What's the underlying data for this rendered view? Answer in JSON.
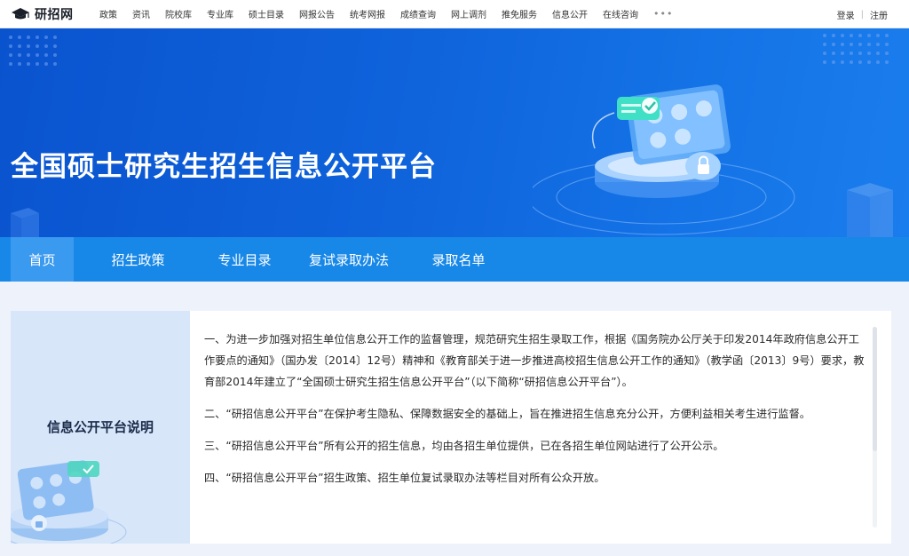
{
  "site": {
    "logo_text": "研招网"
  },
  "topnav": {
    "items": [
      {
        "label": "政策"
      },
      {
        "label": "资讯"
      },
      {
        "label": "院校库"
      },
      {
        "label": "专业库"
      },
      {
        "label": "硕士目录"
      },
      {
        "label": "网报公告"
      },
      {
        "label": "统考网报"
      },
      {
        "label": "成绩查询"
      },
      {
        "label": "网上调剂"
      },
      {
        "label": "推免服务"
      },
      {
        "label": "信息公开"
      },
      {
        "label": "在线咨询"
      }
    ],
    "more": "•••",
    "login": "登录",
    "separator": "|",
    "register": "注册"
  },
  "banner": {
    "title": "全国硕士研究生招生信息公开平台"
  },
  "tabs": {
    "items": [
      {
        "label": "首页",
        "active": true
      },
      {
        "label": "招生政策",
        "active": false
      },
      {
        "label": "专业目录",
        "active": false
      },
      {
        "label": "复试录取办法",
        "active": false
      },
      {
        "label": "录取名单",
        "active": false
      }
    ]
  },
  "info": {
    "side_title": "信息公开平台说明",
    "paragraphs": [
      "一、为进一步加强对招生单位信息公开工作的监督管理，规范研究生招生录取工作，根据《国务院办公厅关于印发2014年政府信息公开工作要点的通知》（国办发〔2014〕12号）精神和《教育部关于进一步推进高校招生信息公开工作的通知》（教学函〔2013〕9号）要求，教育部2014年建立了“全国硕士研究生招生信息公开平台”（以下简称“研招信息公开平台”）。",
      "二、“研招信息公开平台”在保护考生隐私、保障数据安全的基础上，旨在推进招生信息充分公开，方便利益相关考生进行监督。",
      "三、“研招信息公开平台”所有公开的招生信息，均由各招生单位提供，已在各招生单位网站进行了公开公示。",
      "四、“研招信息公开平台”招生政策、招生单位复试录取办法等栏目对所有公众开放。"
    ]
  },
  "colors": {
    "brand_blue": "#0f63db",
    "tab_bar": "#1888e8",
    "tab_active": "#3a9af0",
    "page_bg": "#eef3fb",
    "side_bg": "#d8e6f9"
  },
  "icons": {
    "logo": "graduation-cap-icon",
    "banner_art": "secure-profile-card-illustration",
    "lock": "lock-icon",
    "check": "check-icon"
  }
}
